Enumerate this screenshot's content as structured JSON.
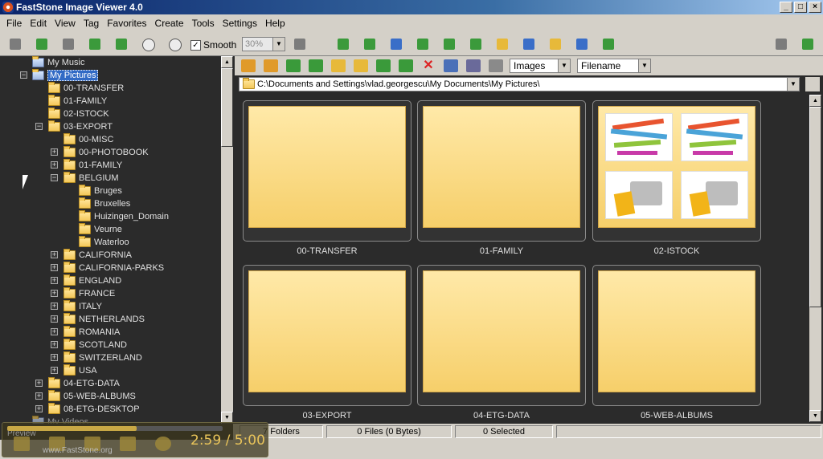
{
  "window": {
    "title": "FastStone Image Viewer 4.0"
  },
  "menu": [
    "File",
    "Edit",
    "View",
    "Tag",
    "Favorites",
    "Create",
    "Tools",
    "Settings",
    "Help"
  ],
  "toolbar": {
    "smooth_label": "Smooth",
    "smooth_checked": "✓",
    "zoom_value": "30%"
  },
  "navbar": {
    "filter_value": "Images",
    "sort_value": "Filename"
  },
  "path": "C:\\Documents and Settings\\vlad.georgescu\\My Documents\\My Pictures\\",
  "tree": {
    "my_music": "My Music",
    "my_pictures": "My Pictures",
    "my_videos": "My Videos",
    "level1": [
      "00-TRANSFER",
      "01-FAMILY",
      "02-ISTOCK",
      "03-EXPORT"
    ],
    "export_children": [
      "00-MISC",
      "00-PHOTOBOOK",
      "01-FAMILY",
      "BELGIUM"
    ],
    "belgium_children": [
      "Bruges",
      "Bruxelles",
      "Huizingen_Domain",
      "Veurne",
      "Waterloo"
    ],
    "export_more": [
      "CALIFORNIA",
      "CALIFORNIA-PARKS",
      "ENGLAND",
      "FRANCE",
      "ITALY",
      "NETHERLANDS",
      "ROMANIA",
      "SCOTLAND",
      "SWITZERLAND",
      "USA"
    ],
    "level1_more": [
      "04-ETG-DATA",
      "05-WEB-ALBUMS",
      "08-ETG-DESKTOP"
    ]
  },
  "thumbnails": [
    "00-TRANSFER",
    "01-FAMILY",
    "02-ISTOCK",
    "03-EXPORT",
    "04-ETG-DATA",
    "05-WEB-ALBUMS"
  ],
  "status": {
    "folders": "7 Folders",
    "files": "0 Files (0 Bytes)",
    "selected": "0 Selected"
  },
  "overlay": {
    "preview_label": "Preview",
    "site": "www.FastStone.org",
    "time": "2:59 / 5:00",
    "progress_fraction": 0.6
  }
}
